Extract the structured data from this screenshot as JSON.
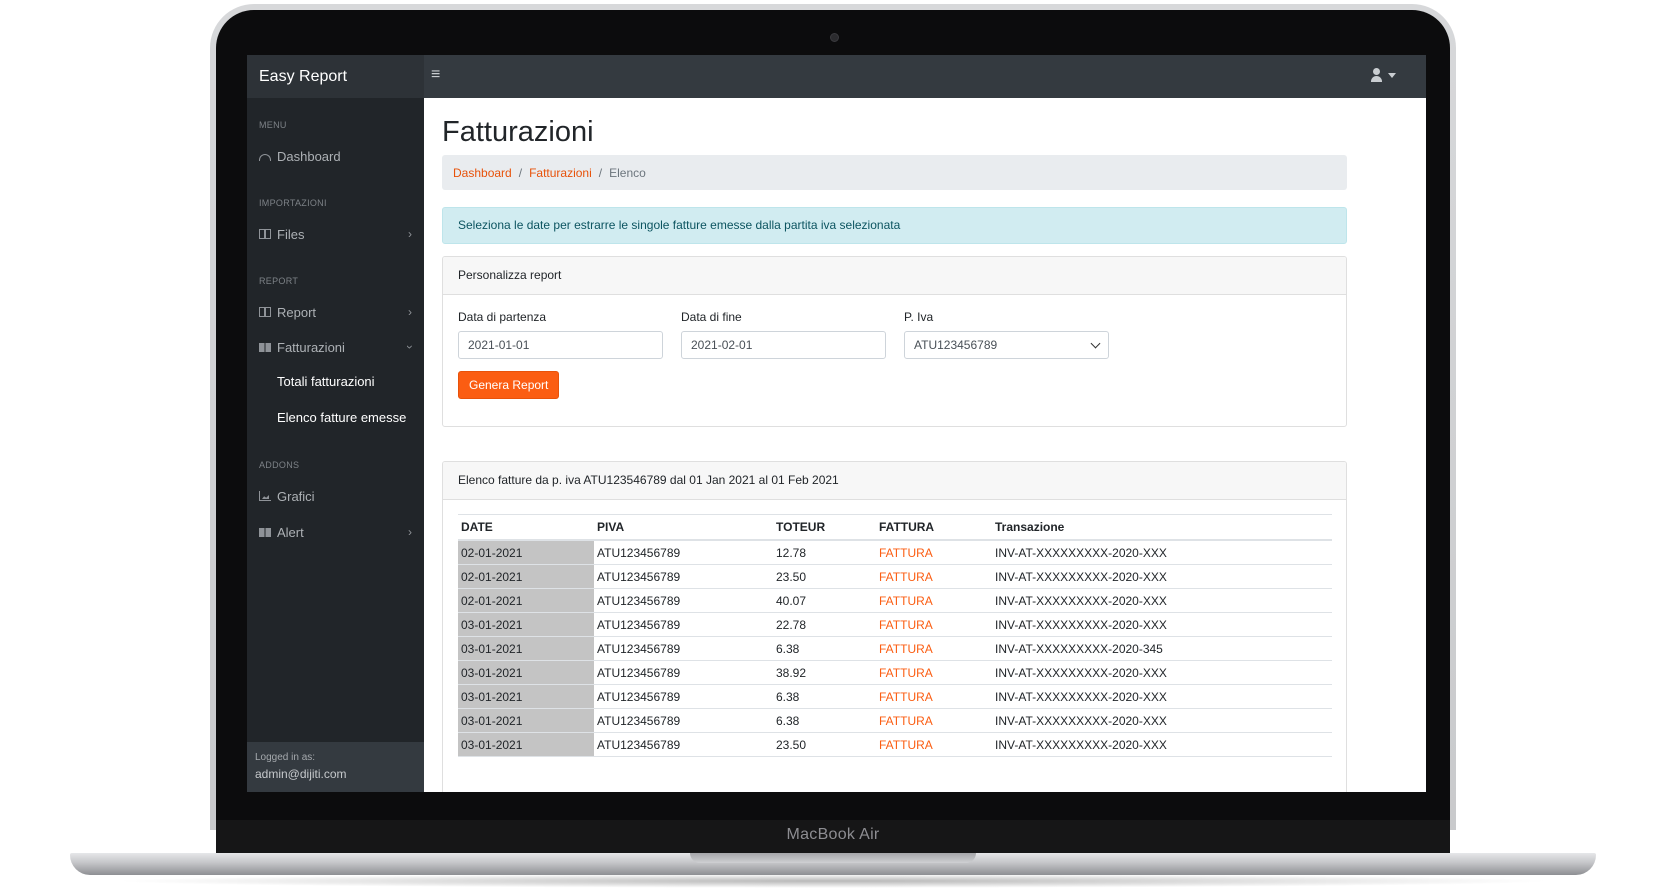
{
  "device": {
    "label": "MacBook Air"
  },
  "app": {
    "brand": "Easy Report"
  },
  "topbar": {
    "menu_toggle_icon": "≡"
  },
  "sidebar": {
    "sections": [
      {
        "heading": "MENU"
      },
      {
        "heading": "IMPORTAZIONI"
      },
      {
        "heading": "REPORT"
      },
      {
        "heading": "ADDONS"
      }
    ],
    "items": [
      {
        "label": "Dashboard",
        "icon": "dashboard-icon"
      },
      {
        "label": "Files",
        "icon": "table-icon"
      },
      {
        "label": "Report",
        "icon": "table-icon"
      },
      {
        "label": "Fatturazioni",
        "icon": "book-icon"
      },
      {
        "label": "Grafici",
        "icon": "chart-icon"
      },
      {
        "label": "Alert",
        "icon": "book-icon"
      }
    ],
    "subitems": [
      {
        "label": "Totali fatturazioni"
      },
      {
        "label": "Elenco fatture emesse"
      }
    ],
    "footer": {
      "logged_in_label": "Logged in as:",
      "user": "admin@dijiti.com"
    }
  },
  "page": {
    "title": "Fatturazioni",
    "breadcrumb": {
      "items": [
        "Dashboard",
        "Fatturazioni"
      ],
      "current": "Elenco"
    },
    "alert": "Seleziona le date per estrarre le singole fatture emesse dalla partita iva selezionata"
  },
  "form": {
    "header": "Personalizza report",
    "start_label": "Data di partenza",
    "start_value": "2021-01-01",
    "end_label": "Data di fine",
    "end_value": "2021-02-01",
    "piva_label": "P. Iva",
    "piva_value": "ATU123456789",
    "submit_label": "Genera Report"
  },
  "list": {
    "header": "Elenco fatture da p. iva ATU123546789 dal 01 Jan 2021 al 01 Feb 2021",
    "columns": [
      "DATE",
      "PIVA",
      "TOTEUR",
      "FATTURA",
      "Transazione"
    ],
    "rows": [
      {
        "date": "02-01-2021",
        "piva": "ATU123456789",
        "toteur": "12.78",
        "fattura": "FATTURA",
        "transazione": "INV-AT-XXXXXXXXX-2020-XXX"
      },
      {
        "date": "02-01-2021",
        "piva": "ATU123456789",
        "toteur": "23.50",
        "fattura": "FATTURA",
        "transazione": "INV-AT-XXXXXXXXX-2020-XXX"
      },
      {
        "date": "02-01-2021",
        "piva": "ATU123456789",
        "toteur": "40.07",
        "fattura": "FATTURA",
        "transazione": "INV-AT-XXXXXXXXX-2020-XXX"
      },
      {
        "date": "03-01-2021",
        "piva": "ATU123456789",
        "toteur": "22.78",
        "fattura": "FATTURA",
        "transazione": "INV-AT-XXXXXXXXX-2020-XXX"
      },
      {
        "date": "03-01-2021",
        "piva": "ATU123456789",
        "toteur": "6.38",
        "fattura": "FATTURA",
        "transazione": "INV-AT-XXXXXXXXX-2020-345"
      },
      {
        "date": "03-01-2021",
        "piva": "ATU123456789",
        "toteur": "38.92",
        "fattura": "FATTURA",
        "transazione": "INV-AT-XXXXXXXXX-2020-XXX"
      },
      {
        "date": "03-01-2021",
        "piva": "ATU123456789",
        "toteur": "6.38",
        "fattura": "FATTURA",
        "transazione": "INV-AT-XXXXXXXXX-2020-XXX"
      },
      {
        "date": "03-01-2021",
        "piva": "ATU123456789",
        "toteur": "6.38",
        "fattura": "FATTURA",
        "transazione": "INV-AT-XXXXXXXXX-2020-XXX"
      },
      {
        "date": "03-01-2021",
        "piva": "ATU123456789",
        "toteur": "23.50",
        "fattura": "FATTURA",
        "transazione": "INV-AT-XXXXXXXXX-2020-XXX"
      }
    ]
  },
  "colors": {
    "accent": "#fb5d12",
    "sidebar": "#212529",
    "topbar": "#343a40",
    "alert_bg": "#d1ecf1"
  }
}
